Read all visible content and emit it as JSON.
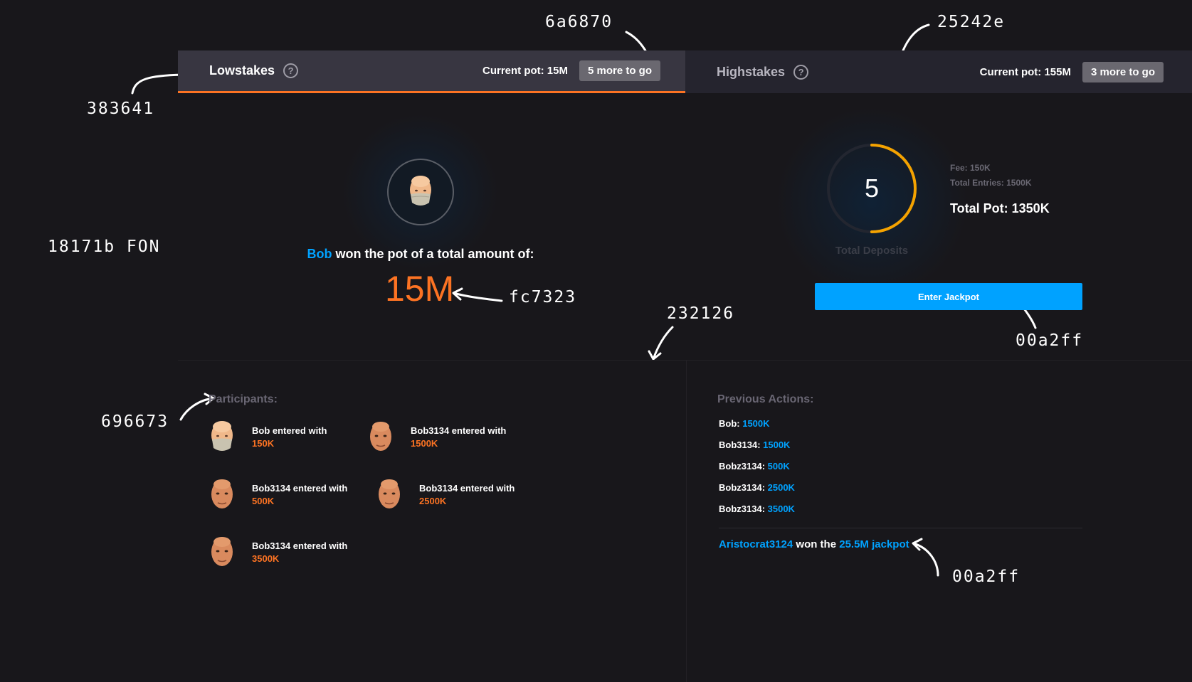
{
  "tabs": [
    {
      "title": "Lowstakes",
      "pot": "Current pot: 15M",
      "badge": "5 more to go"
    },
    {
      "title": "Highstakes",
      "pot": "Current pot: 155M",
      "badge": "3 more to go"
    }
  ],
  "help_glyph": "?",
  "winner": {
    "name": "Bob",
    "text": " won the pot of a total amount of:",
    "amount": "15M"
  },
  "deposits": {
    "count": "5",
    "progress": 0.5,
    "label": "Total Deposits",
    "fee": "Fee: 150K",
    "entries": "Total Entries: 1500K",
    "total_pot": "Total Pot: 1350K",
    "button": "Enter Jackpot"
  },
  "participants": {
    "title": "Participants:",
    "items": [
      {
        "text": "Bob entered with",
        "amount": "150K",
        "mask": true
      },
      {
        "text": "Bob3134 entered with",
        "amount": "1500K",
        "mask": false
      },
      {
        "text": "Bob3134 entered with",
        "amount": "500K",
        "mask": false
      },
      {
        "text": "Bob3134 entered with",
        "amount": "2500K",
        "mask": false
      },
      {
        "text": "Bob3134 entered with",
        "amount": "3500K",
        "mask": false
      }
    ]
  },
  "actions": {
    "title": "Previous Actions:",
    "items": [
      {
        "name": "Bob: ",
        "amount": "1500K"
      },
      {
        "name": "Bob3134: ",
        "amount": "1500K"
      },
      {
        "name": "Bobz3134: ",
        "amount": "500K"
      },
      {
        "name": "Bobz3134: ",
        "amount": "2500K"
      },
      {
        "name": "Bobz3134: ",
        "amount": "3500K"
      }
    ],
    "jackpot": {
      "winner": "Aristocrat3124",
      "middle": " won the ",
      "prize": "25.5M jackpot"
    }
  },
  "annotations": {
    "a1": "6a6870",
    "a2": "25242e",
    "a3": "383641",
    "a4": "18171b FON",
    "a5": "fc7323",
    "a6": "232126",
    "a7": "00a2ff",
    "a8": "696673",
    "a9": "00a2ff"
  },
  "colors": {
    "background": "#18171b",
    "tab_active": "#383641",
    "tab_inactive": "#25242e",
    "badge": "#6a6870",
    "accent_orange": "#fc7323",
    "accent_blue": "#00a2ff",
    "divider": "#232126",
    "muted_text": "#696673"
  }
}
